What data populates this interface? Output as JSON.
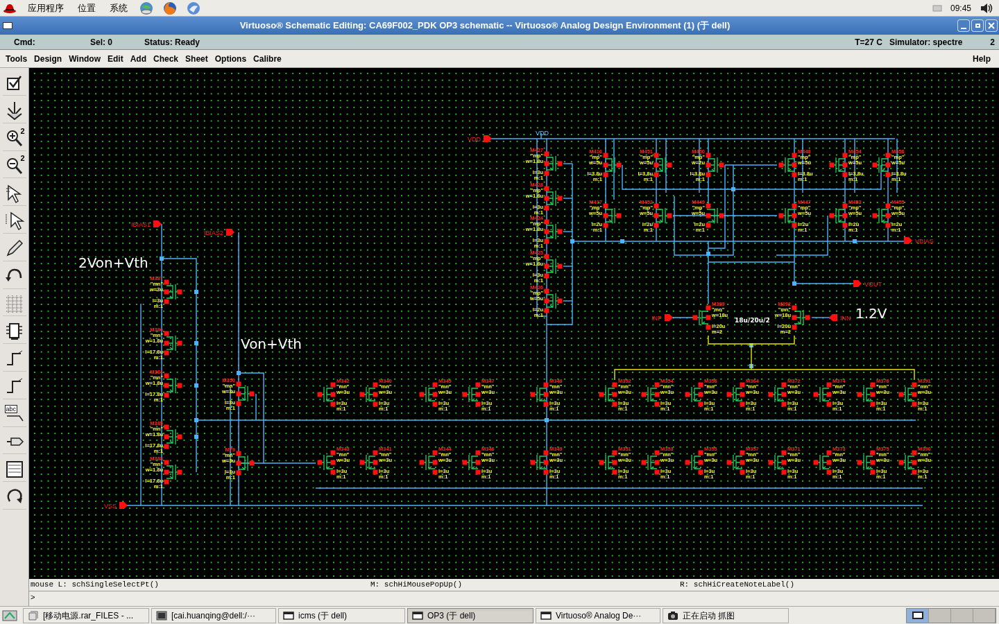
{
  "top_panel": {
    "menus": [
      "应用程序",
      "位置",
      "系统"
    ],
    "clock": "09:45"
  },
  "window": {
    "title": "Virtuoso® Schematic Editing: CA69F002_PDK OP3 schematic -- Virtuoso® Analog Design Environment (1) (于 dell)"
  },
  "status": {
    "cmd": "Cmd:",
    "sel": "Sel: 0",
    "status": "Status: Ready",
    "temperature": "T=27 C",
    "simulator": "Simulator: spectre",
    "number": "2"
  },
  "menu": [
    "Tools",
    "Design",
    "Window",
    "Edit",
    "Add",
    "Check",
    "Sheet",
    "Options",
    "Calibre"
  ],
  "help": "Help",
  "tools": [
    {
      "kind": "check"
    },
    {
      "kind": "save"
    },
    {
      "kind": "zoom-in",
      "label": "2"
    },
    {
      "kind": "zoom-out",
      "label": "2"
    },
    {
      "kind": "stretch"
    },
    {
      "kind": "copy"
    },
    {
      "kind": "pencil"
    },
    {
      "kind": "undo"
    },
    {
      "kind": "property"
    },
    {
      "kind": "instance"
    },
    {
      "kind": "wire"
    },
    {
      "kind": "wire"
    },
    {
      "kind": "label",
      "label": "abc"
    },
    {
      "kind": "pin"
    },
    {
      "kind": "sheet"
    },
    {
      "kind": "redo"
    }
  ],
  "schematic": {
    "pins": [
      {
        "kind": "in",
        "label": "VDD"
      },
      {
        "kind": "in",
        "label": "IBIAS1"
      },
      {
        "kind": "in",
        "label": "IBIAS2"
      },
      {
        "kind": "in",
        "label": "VSS"
      },
      {
        "kind": "out",
        "label": "VBIAS"
      },
      {
        "kind": "out",
        "label": "VOUT"
      },
      {
        "kind": "in",
        "label": "INP"
      },
      {
        "kind": "in-left",
        "label": "INN"
      }
    ],
    "net_labels": [
      "VDD"
    ],
    "notes": [
      "2Von+Vth",
      "Von+Vth",
      "1.2V",
      "18u/20u/2"
    ],
    "transistors": [
      {
        "name": "M387",
        "model": "\"mn\"",
        "w": "w=3u",
        "l": "l=3u",
        "m": "m:1"
      },
      {
        "name": "M386",
        "model": "\"mn\"",
        "w": "w=1.8u",
        "l": "l=17.8u",
        "m": "m:1"
      },
      {
        "name": "M384",
        "model": "\"mn\"",
        "w": "w=1.8u",
        "l": "l=17.8u",
        "m": "m:1"
      },
      {
        "name": "M385",
        "model": "\"mn\"",
        "w": "w=1.8u",
        "l": "l=17.8u",
        "m": "m:1"
      },
      {
        "name": "M388",
        "model": "\"mn\"",
        "w": "w=1.8u",
        "l": "l=17.8u",
        "m": "m:1"
      },
      {
        "name": "M350",
        "model": "\"mn\"",
        "w": "w=3u",
        "l": "l=3u",
        "m": "m:1"
      },
      {
        "name": "M79",
        "model": "\"mn\"",
        "w": "w=3u",
        "l": "l=3u",
        "m": "m:1"
      },
      {
        "name": "M427",
        "model": "\"mp\"",
        "w": "w=1.8u",
        "l": "l=3u",
        "m": "m:1"
      },
      {
        "name": "M428",
        "model": "\"mp\"",
        "w": "w=1.8u",
        "l": "l=3u",
        "m": "m:1"
      },
      {
        "name": "M424",
        "model": "\"mp\"",
        "w": "w=1.8u",
        "l": "l=3u",
        "m": "m:1"
      },
      {
        "name": "M425",
        "model": "\"mp\"",
        "w": "w=1.8u",
        "l": "l=3u",
        "m": "m:1"
      },
      {
        "name": "M426",
        "model": "\"mp\"",
        "w": "w=5u",
        "l": "l=2u",
        "m": "m:1"
      },
      {
        "name": "M416",
        "model": "\"mp\"",
        "w": "w=5u",
        "l": "l=3.8u",
        "m": "m:1"
      },
      {
        "name": "M451",
        "model": "\"mp\"",
        "w": "w=5u",
        "l": "l=3.8u",
        "m": "m:1"
      },
      {
        "name": "M450",
        "model": "\"mp\"",
        "w": "w=2u",
        "l": "l=3.8u",
        "m": "m:1"
      },
      {
        "name": "M448",
        "model": "\"mp\"",
        "w": "w=5u",
        "l": "l=3.8u",
        "m": "m:1"
      },
      {
        "name": "M454",
        "model": "\"mp\"",
        "w": "w=5u",
        "l": "l=3.8u",
        "m": "m:1"
      },
      {
        "name": "M456",
        "model": "\"mp\"",
        "w": "w=5u",
        "l": "l=3.8u",
        "m": "m:1"
      },
      {
        "name": "M417",
        "model": "\"mp\"",
        "w": "w=5u",
        "l": "l=2u",
        "m": "m:1"
      },
      {
        "name": "M452",
        "model": "\"mp\"",
        "w": "w=5u",
        "l": "l=2u",
        "m": "m:1"
      },
      {
        "name": "M449",
        "model": "\"mp\"",
        "w": "w=5u",
        "l": "l=2u",
        "m": "m:1"
      },
      {
        "name": "M447",
        "model": "\"mp\"",
        "w": "w=5u",
        "l": "l=2u",
        "m": "m:1"
      },
      {
        "name": "M453",
        "model": "\"mp\"",
        "w": "w=5u",
        "l": "l=2u",
        "m": "m:1"
      },
      {
        "name": "M455",
        "model": "\"mp\"",
        "w": "w=5u",
        "l": "l=2u",
        "m": "m:1"
      },
      {
        "name": "M389",
        "model": "\"mn\"",
        "w": "w=18u",
        "l": "l=20u",
        "m": "m=2"
      },
      {
        "name": "M392",
        "model": "\"mn\"",
        "w": "w=18u",
        "l": "l=20u",
        "m": "m=2"
      },
      {
        "name": "M342",
        "model": "\"mn\"",
        "w": "w=3u",
        "l": "l=3u",
        "m": "m:1"
      },
      {
        "name": "M340",
        "model": "\"mn\"",
        "w": "w=3u",
        "l": "l=3u",
        "m": "m:1"
      },
      {
        "name": "M345",
        "model": "\"mn\"",
        "w": "w=3u",
        "l": "l=3u",
        "m": "m:1"
      },
      {
        "name": "M347",
        "model": "\"mn\"",
        "w": "w=3u",
        "l": "l=3u",
        "m": "m:1"
      },
      {
        "name": "M348",
        "model": "\"mn\"",
        "w": "w=3u",
        "l": "l=3u",
        "m": "m:1"
      },
      {
        "name": "M352",
        "model": "\"mn\"",
        "w": "w=3u",
        "l": "l=3u",
        "m": "m:1"
      },
      {
        "name": "M354",
        "model": "\"mn\"",
        "w": "w=3u",
        "l": "l=3u",
        "m": "m:1"
      },
      {
        "name": "M356",
        "model": "\"mn\"",
        "w": "w=3u",
        "l": "l=3u",
        "m": "m:1"
      },
      {
        "name": "M364",
        "model": "\"mn\"",
        "w": "w=3u",
        "l": "l=3u",
        "m": "m:1"
      },
      {
        "name": "M372",
        "model": "\"mn\"",
        "w": "w=3u",
        "l": "l=3u",
        "m": "m:1"
      },
      {
        "name": "M374",
        "model": "\"mn\"",
        "w": "w=3u",
        "l": "l=3u",
        "m": "m:1"
      },
      {
        "name": "M376",
        "model": "\"mn\"",
        "w": "w=3u",
        "l": "l=3u",
        "m": "m:1"
      },
      {
        "name": "M391",
        "model": "\"mn\"",
        "w": "w=3u",
        "l": "l=3u",
        "m": "m:1"
      },
      {
        "name": "M343",
        "model": "\"mn\"",
        "w": "w=3u",
        "l": "l=3u",
        "m": "m:1"
      },
      {
        "name": "M341",
        "model": "\"mn\"",
        "w": "w=3u",
        "l": "l=3u",
        "m": "m:1"
      },
      {
        "name": "M344",
        "model": "\"mn\"",
        "w": "w=3u",
        "l": "l=3u",
        "m": "m:1"
      },
      {
        "name": "M346",
        "model": "\"mn\"",
        "w": "w=3u",
        "l": "l=3u",
        "m": "m:1"
      },
      {
        "name": "M349",
        "model": "\"mn\"",
        "w": "w=3u",
        "l": "l=3u",
        "m": "m:1"
      },
      {
        "name": "M351",
        "model": "\"mn\"",
        "w": "w=3u",
        "l": "l=3u",
        "m": "m:1"
      },
      {
        "name": "M353",
        "model": "\"mn\"",
        "w": "w=3u",
        "l": "l=3u",
        "m": "m:1"
      },
      {
        "name": "M355",
        "model": "\"mn\"",
        "w": "w=3u",
        "l": "l=3u",
        "m": "m:1"
      },
      {
        "name": "M357",
        "model": "\"mn\"",
        "w": "w=3u",
        "l": "l=3u",
        "m": "m:1"
      },
      {
        "name": "M371",
        "model": "\"mn\"",
        "w": "w=3u",
        "l": "l=3u",
        "m": "m:1"
      },
      {
        "name": "M373",
        "model": "\"mn\"",
        "w": "w=3u",
        "l": "l=3u",
        "m": "m:1"
      },
      {
        "name": "M375",
        "model": "\"mn\"",
        "w": "w=3u",
        "l": "l=3u",
        "m": "m:1"
      },
      {
        "name": "M390",
        "model": "\"mn\"",
        "w": "w=3u",
        "l": "l=3u",
        "m": "m:1"
      }
    ]
  },
  "mouse_bar": {
    "left": "mouse L: schSingleSelectPt()",
    "middle": "M: schHiMousePopUp()",
    "right": "R: schHiCreateNoteLabel()"
  },
  "prompt": ">",
  "taskbar": {
    "items": [
      {
        "kind": "files",
        "label": "[移动电源.rar_FILES - ...",
        "selected": false
      },
      {
        "kind": "terminal",
        "label": "[cai.huanqing@dell:/···",
        "selected": false
      },
      {
        "kind": "window",
        "label": "icms (于 dell)",
        "selected": false
      },
      {
        "kind": "window",
        "label": "OP3 (于 dell)",
        "selected": true
      },
      {
        "kind": "window",
        "label": "Virtuoso® Analog De···",
        "selected": false
      },
      {
        "kind": "camera",
        "label": "正在启动 抓图",
        "selected": false
      }
    ],
    "workspaces": [
      {
        "selected": true
      },
      {
        "selected": false
      },
      {
        "selected": false
      },
      {
        "selected": false
      }
    ]
  }
}
